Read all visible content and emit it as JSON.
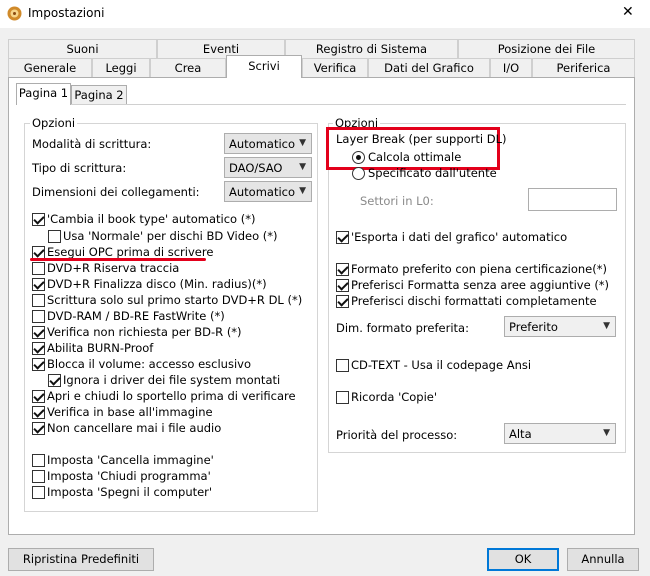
{
  "window": {
    "title": "Impostazioni",
    "close_glyph": "✕"
  },
  "tabs_row1": [
    "Suoni",
    "Eventi",
    "Registro di Sistema",
    "Posizione dei File"
  ],
  "tabs_row2": [
    "Generale",
    "Leggi",
    "Crea",
    "Scrivi",
    "Verifica",
    "Dati del Grafico",
    "I/O",
    "Periferica"
  ],
  "active_tab": "Scrivi",
  "subtabs": [
    "Pagina 1",
    "Pagina 2"
  ],
  "left_group": {
    "title": "Opzioni",
    "fields": [
      {
        "label": "Modalità di scrittura:",
        "value": "Automatico"
      },
      {
        "label": "Tipo di scrittura:",
        "value": "DAO/SAO"
      },
      {
        "label": "Dimensioni dei collegamenti:",
        "value": "Automatico"
      }
    ],
    "checkboxes": [
      {
        "label": "'Cambia il book type' automatico (*)",
        "checked": true
      },
      {
        "label": "Usa 'Normale' per dischi BD Video (*)",
        "checked": false
      },
      {
        "label": "Esegui OPC prima di scrivere",
        "checked": true
      },
      {
        "label": "DVD+R Riserva traccia",
        "checked": false
      },
      {
        "label": "DVD+R Finalizza disco (Min. radius)(*)",
        "checked": true
      },
      {
        "label": "Scrittura solo sul primo starto DVD+R DL (*)",
        "checked": false
      },
      {
        "label": "DVD-RAM / BD-RE FastWrite (*)",
        "checked": false
      },
      {
        "label": "Verifica non richiesta per BD-R (*)",
        "checked": true
      },
      {
        "label": "Abilita BURN-Proof",
        "checked": true
      },
      {
        "label": "Blocca il volume: accesso esclusivo",
        "checked": true
      },
      {
        "label": "Ignora i driver dei file system montati",
        "checked": true
      },
      {
        "label": "Apri e chiudi lo sportello prima di verificare",
        "checked": true
      },
      {
        "label": "Verifica in base all'immagine",
        "checked": true
      },
      {
        "label": "Non cancellare mai i file audio",
        "checked": true
      },
      {
        "label": "Imposta 'Cancella immagine'",
        "checked": false
      },
      {
        "label": "Imposta 'Chiudi programma'",
        "checked": false
      },
      {
        "label": "Imposta 'Spegni il computer'",
        "checked": false
      }
    ]
  },
  "right_group": {
    "title": "Opzioni",
    "layer_break_label": "Layer Break (per supporti DL)",
    "radios": [
      {
        "label": "Calcola ottimale",
        "selected": true
      },
      {
        "label": "Specificato dall'utente",
        "selected": false
      }
    ],
    "sectors_label": "Settori in L0:",
    "sectors_value": "",
    "checkboxes": [
      {
        "label": "'Esporta i dati del grafico' automatico",
        "checked": true
      },
      {
        "label": "Formato preferito con piena certificazione(*)",
        "checked": true
      },
      {
        "label": "Preferisci Formatta senza aree aggiuntive (*)",
        "checked": true
      },
      {
        "label": "Preferisci dischi formattati completamente",
        "checked": true
      },
      {
        "label": "CD-TEXT - Usa il codepage Ansi",
        "checked": false
      },
      {
        "label": "Ricorda 'Copie'",
        "checked": false
      }
    ],
    "format_label": "Dim. formato preferita:",
    "format_value": "Preferito",
    "priority_label": "Priorità del processo:",
    "priority_value": "Alta"
  },
  "buttons": {
    "reset": "Ripristina Predefiniti",
    "ok": "OK",
    "cancel": "Annulla"
  },
  "annotation_color": "#e3001b"
}
